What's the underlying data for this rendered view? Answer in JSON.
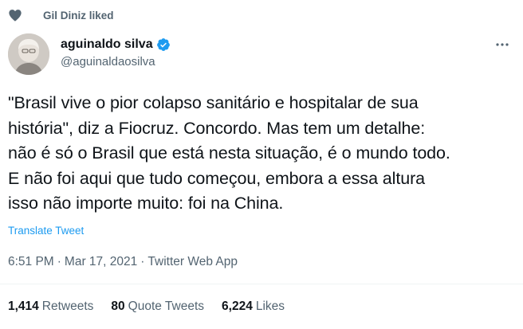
{
  "social_context": {
    "icon": "heart-icon",
    "text": "Gil Diniz liked"
  },
  "author": {
    "display_name": "aguinaldo silva",
    "handle": "@aguinaldaosilva",
    "verified": true,
    "verified_color": "#1d9bf0"
  },
  "tweet": {
    "lines": [
      "\"Brasil vive o pior colapso sanitário e hospitalar de sua",
      "história\", diz a Fiocruz. Concordo. Mas tem um detalhe:",
      "não é só o Brasil que está nesta situação, é o mundo todo.",
      "E não foi aqui que tudo começou, embora a essa altura",
      "isso não importe muito: foi na China."
    ],
    "translate_label": "Translate Tweet"
  },
  "meta": {
    "time": "6:51 PM",
    "separator": "·",
    "date": "Mar 17, 2021",
    "source": "Twitter Web App"
  },
  "stats": {
    "retweets": {
      "count": "1,414",
      "label": "Retweets"
    },
    "quote_tweets": {
      "count": "80",
      "label": "Quote Tweets"
    },
    "likes": {
      "count": "6,224",
      "label": "Likes"
    }
  },
  "colors": {
    "accent": "#1d9bf0",
    "secondary_text": "#536471",
    "primary_text": "#0f1419"
  }
}
